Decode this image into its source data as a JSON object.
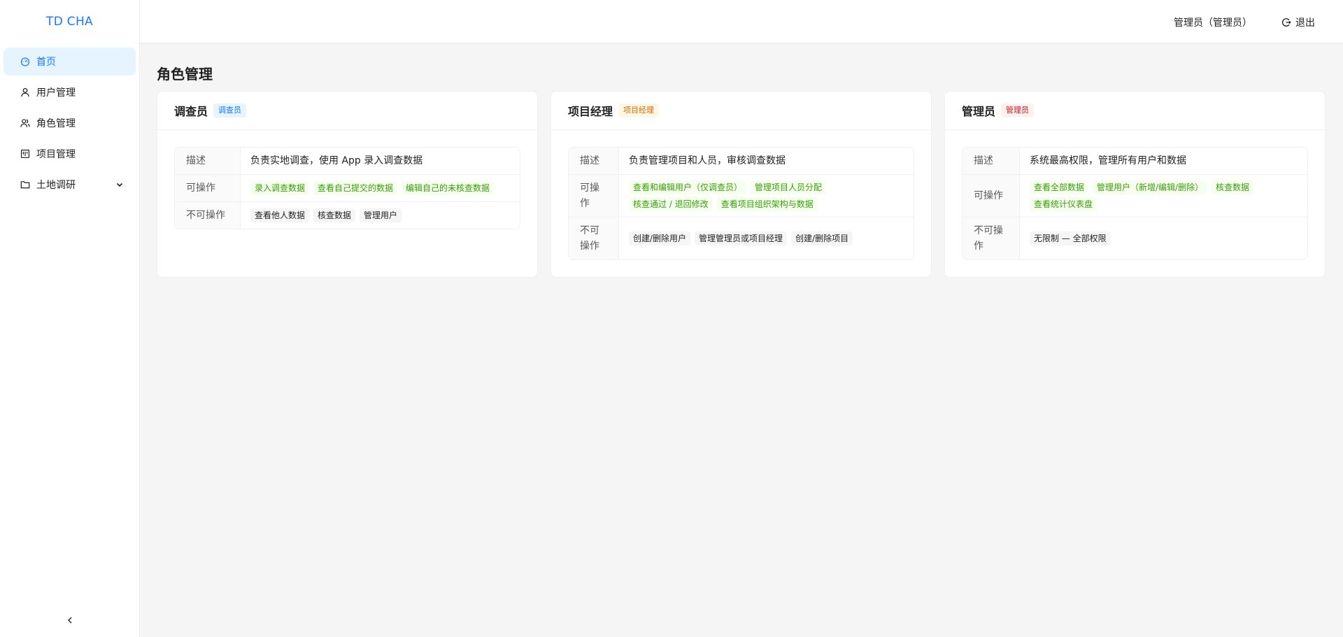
{
  "app": {
    "logo": "TD CHA"
  },
  "sidebar": {
    "items": [
      {
        "label": "首页",
        "icon": "dashboard-icon",
        "active": true
      },
      {
        "label": "用户管理",
        "icon": "user-icon"
      },
      {
        "label": "角色管理",
        "icon": "team-icon"
      },
      {
        "label": "项目管理",
        "icon": "project-icon"
      },
      {
        "label": "土地调研",
        "icon": "folder-icon",
        "expandable": true
      }
    ],
    "collapse_icon": "chevron-left-icon"
  },
  "header": {
    "user": "管理员（管理员）",
    "logout": "退出"
  },
  "page": {
    "title": "角色管理"
  },
  "labels": {
    "desc": "描述",
    "can": "可操作",
    "cannot": "不可操作"
  },
  "roles": [
    {
      "title": "调查员",
      "tag": "调查员",
      "tag_color": "#1677ff",
      "description": "负责实地调查，使用 App 录入调查数据",
      "can": [
        "录入调查数据",
        "查看自己提交的数据",
        "编辑自己的未核查数据"
      ],
      "cannot": [
        "查看他人数据",
        "核查数据",
        "管理用户"
      ]
    },
    {
      "title": "项目经理",
      "tag": "项目经理",
      "tag_color": "#d46b08",
      "description": "负责管理项目和人员，审核调查数据",
      "can": [
        "查看和编辑用户（仅调查员）",
        "管理项目人员分配",
        "核查通过 / 退回修改",
        "查看项目组织架构与数据"
      ],
      "cannot": [
        "创建/删除用户",
        "管理管理员或项目经理",
        "创建/删除项目"
      ]
    },
    {
      "title": "管理员",
      "tag": "管理员",
      "tag_color": "#cf1322",
      "description": "系统最高权限，管理所有用户和数据",
      "can": [
        "查看全部数据",
        "管理用户（新增/编辑/删除）",
        "核查数据",
        "查看统计仪表盘"
      ],
      "cannot": [
        "无限制 — 全部权限"
      ]
    }
  ]
}
